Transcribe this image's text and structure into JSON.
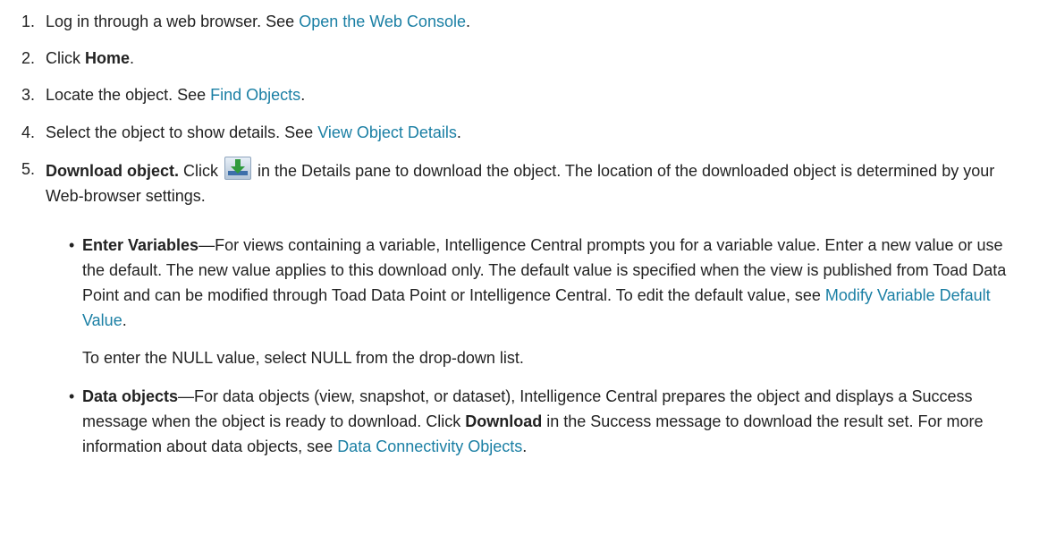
{
  "steps": [
    {
      "num": "1.",
      "pre": "Log in through a web browser. See ",
      "link": "Open the Web Console",
      "post": "."
    },
    {
      "num": "2.",
      "pre": "Click ",
      "bold": "Home",
      "post": "."
    },
    {
      "num": "3.",
      "pre": "Locate the object. See ",
      "link": "Find Objects",
      "post": "."
    },
    {
      "num": "4.",
      "pre": "Select the object to show details. See ",
      "link": "View Object Details",
      "post": "."
    },
    {
      "num": "5.",
      "bold": "Download object.",
      "pre": " Click ",
      "post": " in the Details pane to download the object. The location of the downloaded object is determined by your Web-browser settings.",
      "icon": "download-icon"
    }
  ],
  "bullets": [
    {
      "bold": "Enter Variables",
      "text": "—For views containing a variable, Intelligence Central prompts you for a variable value. Enter a new value or use the default. The new value applies to this download only. The default value is specified when the view is published from Toad Data Point and can be modified through Toad Data Point or Intelligence Central. To edit the default value, see ",
      "link": "Modify Variable Default Value",
      "post": ".",
      "note": "To enter the NULL value, select NULL from the drop-down list."
    },
    {
      "bold": "Data objects",
      "text": "—For data objects (view, snapshot, or dataset), Intelligence Central prepares the object and displays a Success message when the object is ready to download. Click ",
      "bold2": "Download",
      "text2": " in the Success message to download the result set. For more information about data objects, see ",
      "link": "Data Connectivity Objects",
      "post": "."
    }
  ],
  "colors": {
    "text": "#222222",
    "link": "#1a7fa4"
  }
}
